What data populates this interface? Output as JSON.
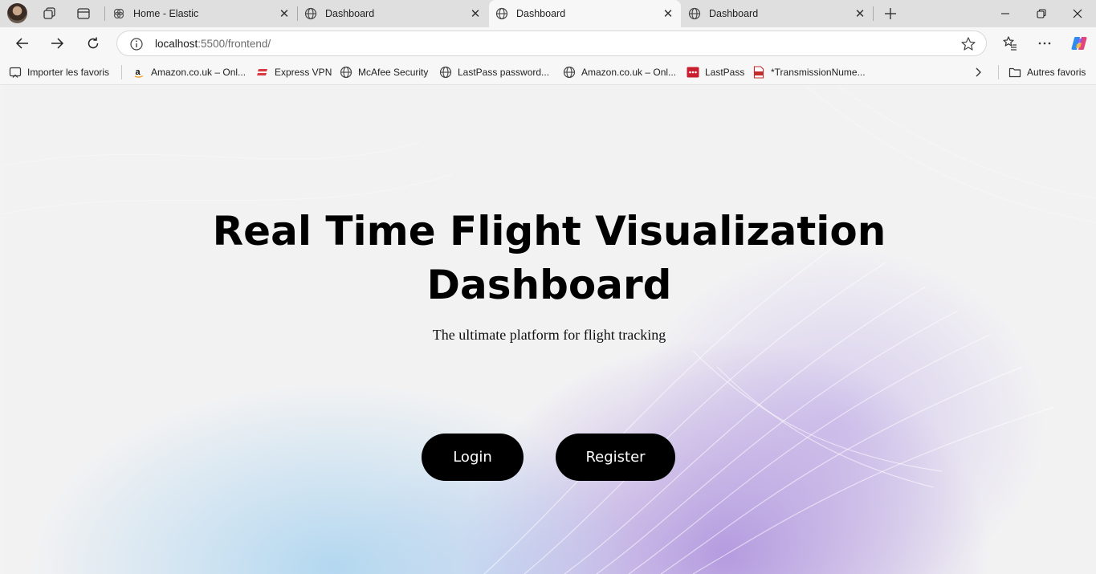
{
  "browser": {
    "tabs": [
      {
        "label": "Home - Elastic",
        "active": false
      },
      {
        "label": "Dashboard",
        "active": false
      },
      {
        "label": "Dashboard",
        "active": true
      },
      {
        "label": "Dashboard",
        "active": false
      }
    ],
    "url_host": "localhost",
    "url_path": ":5500/frontend/"
  },
  "bookmarks": {
    "items": [
      {
        "label": "Importer les favoris",
        "icon": "import-icon"
      },
      {
        "label": "Amazon.co.uk – Onl...",
        "icon": "amazon-icon"
      },
      {
        "label": "Express VPN",
        "icon": "expressvpn-icon"
      },
      {
        "label": "McAfee Security",
        "icon": "globe-icon"
      },
      {
        "label": "LastPass password...",
        "icon": "globe-icon"
      },
      {
        "label": "Amazon.co.uk – Onl...",
        "icon": "globe-icon"
      },
      {
        "label": "LastPass",
        "icon": "lastpass-icon"
      },
      {
        "label": "*TransmissionNume...",
        "icon": "pdf-icon"
      }
    ],
    "other": "Autres favoris"
  },
  "page": {
    "title_line1": "Real Time Flight Visualization",
    "title_line2": "Dashboard",
    "subtitle": "The ultimate platform for flight tracking",
    "login_label": "Login",
    "register_label": "Register"
  },
  "colors": {
    "button_bg": "#000000",
    "button_text": "#ffffff",
    "gradient_blue": "#b0d6f0",
    "gradient_purple": "#aa8cdc"
  }
}
